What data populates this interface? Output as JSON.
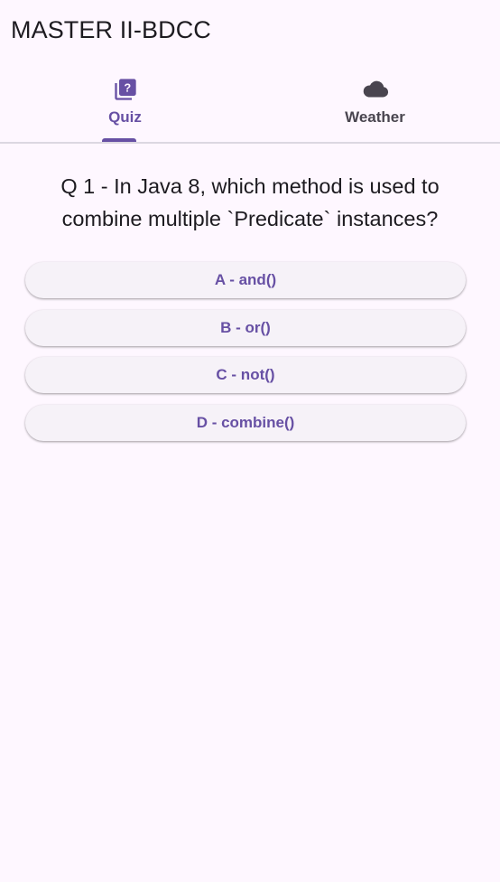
{
  "app_bar": {
    "title": "MASTER II-BDCC"
  },
  "tabs": [
    {
      "label": "Quiz",
      "icon": "quiz-icon",
      "active": true
    },
    {
      "label": "Weather",
      "icon": "cloud-icon",
      "active": false
    }
  ],
  "quiz": {
    "question": "Q 1 - In Java 8, which method is used to combine multiple `Predicate` instances?",
    "answers": [
      "A - and()",
      "B - or()",
      "C - not()",
      "D - combine()"
    ]
  },
  "colors": {
    "background": "#fef7ff",
    "primary": "#6750a4",
    "inactive_tab": "#49454f",
    "button_surface": "#f6f2f8"
  }
}
